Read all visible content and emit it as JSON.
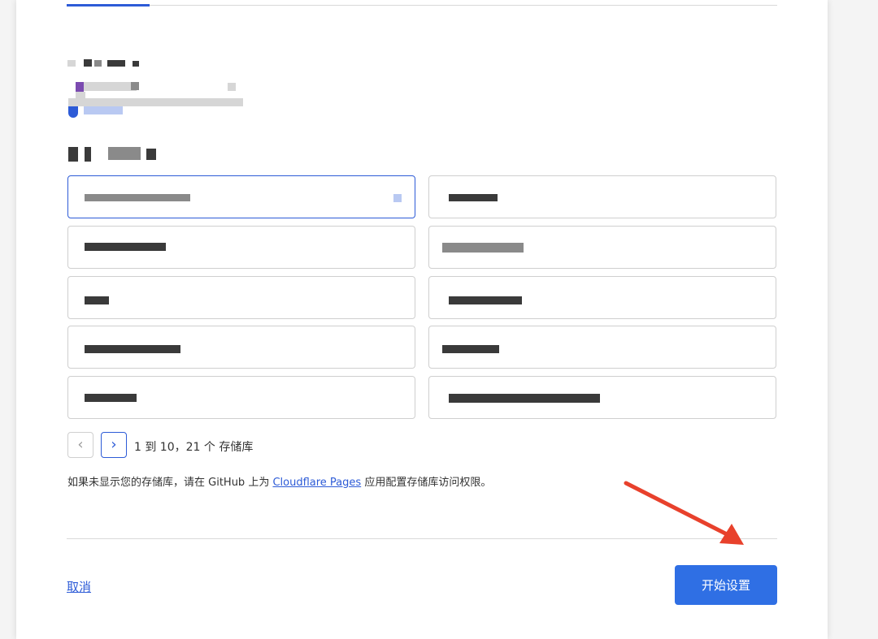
{
  "pagination": {
    "summary": "1 到 10，21 个 存储库",
    "prev_label": "‹",
    "next_label": "›"
  },
  "help_note": {
    "prefix": "如果未显示您的存储库，请在 GitHub 上为 ",
    "link": "Cloudflare Pages",
    "suffix": " 应用配置存储库访问权限。"
  },
  "footer": {
    "cancel_label": "取消",
    "primary_label": "开始设置"
  },
  "colors": {
    "accent": "#2d5bd7",
    "primary_button": "#2f6fe4",
    "annotation_arrow": "#e8412c"
  },
  "icons": {
    "prev": "chevron-left-icon",
    "next": "chevron-right-icon",
    "info": "info-icon"
  }
}
